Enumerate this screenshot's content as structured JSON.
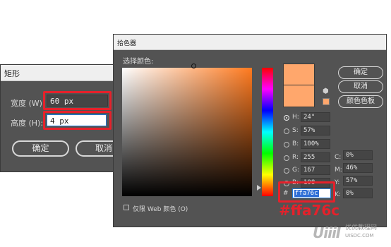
{
  "rect_dialog": {
    "title": "矩形",
    "width_label": "宽度 (W):",
    "width_value": "60 px",
    "height_label": "高度 (H):",
    "height_value": "4 px",
    "ok_label": "确定",
    "cancel_label": "取消"
  },
  "picker": {
    "title": "拾色器",
    "select_label": "选择颜色:",
    "ok_label": "确定",
    "cancel_label": "取消",
    "swatches_label": "颜色色板",
    "hsb": [
      {
        "label": "H:",
        "value": "24°",
        "selected": true
      },
      {
        "label": "S:",
        "value": "57%",
        "selected": false
      },
      {
        "label": "B:",
        "value": "100%",
        "selected": false
      }
    ],
    "rgb": [
      {
        "label": "R:",
        "value": "255"
      },
      {
        "label": "G:",
        "value": "167"
      },
      {
        "label": "B:",
        "value": "108"
      }
    ],
    "cmyk": [
      {
        "label": "C:",
        "value": "0%"
      },
      {
        "label": "M:",
        "value": "46%"
      },
      {
        "label": "Y:",
        "value": "57%"
      },
      {
        "label": "K:",
        "value": "0%"
      }
    ],
    "hex_prefix": "#",
    "hex_value": "ffa76c",
    "web_only_label": "仅限 Web 颜色 (O)",
    "current_color": "#ffa76c"
  },
  "annotation": {
    "hex_text": "#ffa76c"
  },
  "watermark": {
    "logo": "UiiiI",
    "site_name": "优优教程网",
    "url": "UISDC.COM"
  },
  "colors": {
    "dialog_bg": "#535353",
    "highlight_red": "#e5212b",
    "selection_blue": "#2f6fd6"
  }
}
